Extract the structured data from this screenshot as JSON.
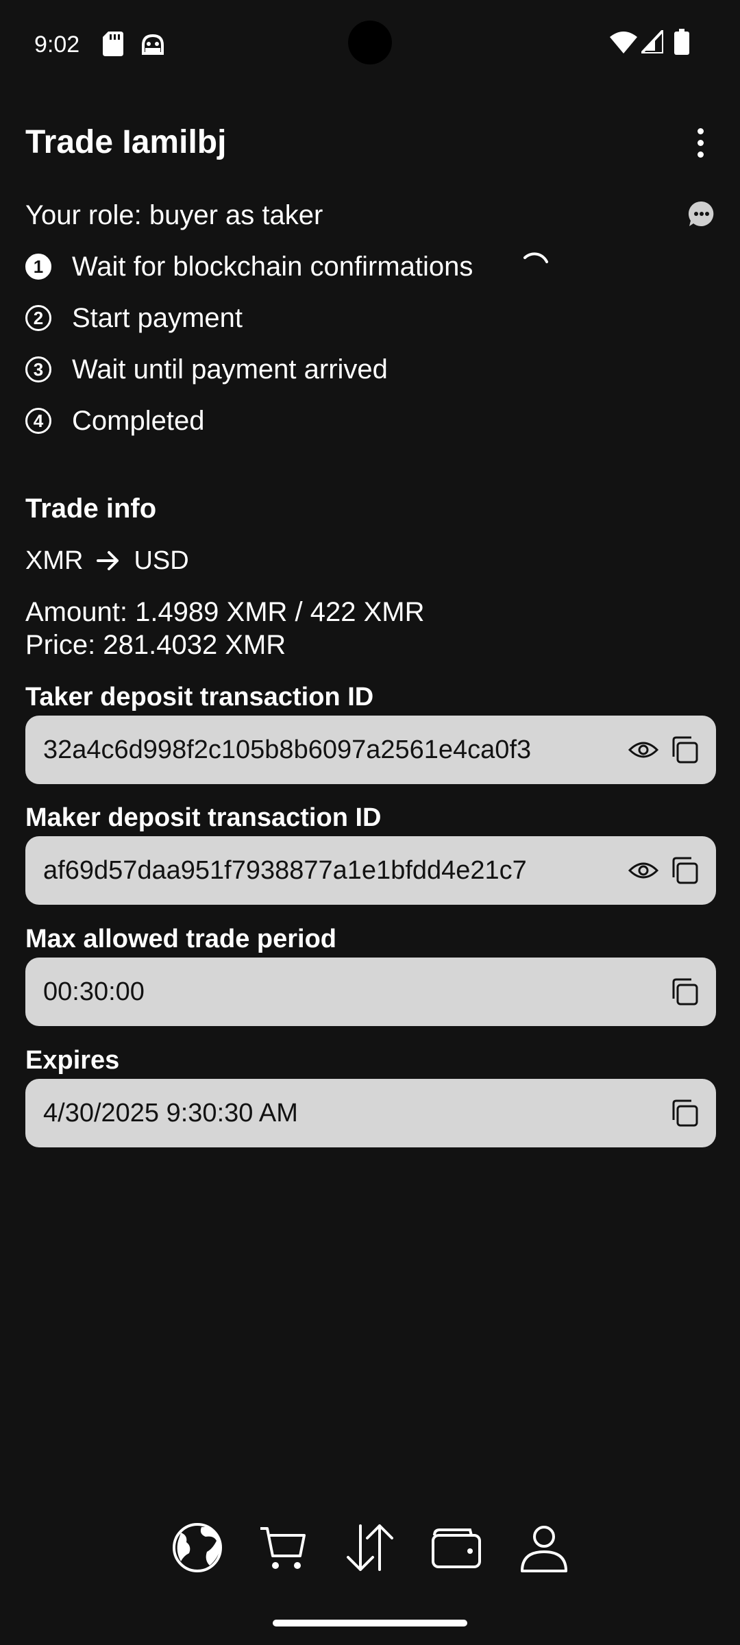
{
  "status_bar": {
    "time": "9:02",
    "icons": [
      "sd-card-icon",
      "android-debug-icon",
      "wifi-icon",
      "cell-signal-icon",
      "battery-icon"
    ]
  },
  "header": {
    "title": "Trade Iamilbj",
    "menu_icon": "more-vert-icon"
  },
  "role": {
    "text": "Your role: buyer as taker",
    "chat_icon": "chat-bubble-icon"
  },
  "steps": [
    {
      "number": "1",
      "label": "Wait for blockchain confirmations",
      "active": true
    },
    {
      "number": "2",
      "label": "Start payment",
      "active": false
    },
    {
      "number": "3",
      "label": "Wait until payment arrived",
      "active": false
    },
    {
      "number": "4",
      "label": "Completed",
      "active": false
    }
  ],
  "trade_info": {
    "title": "Trade info",
    "from_currency": "XMR",
    "to_currency": "USD",
    "amount": "Amount: 1.4989 XMR / 422 XMR",
    "price": "Price: 281.4032 XMR"
  },
  "fields": [
    {
      "label": "Taker deposit transaction ID",
      "value": "32a4c6d998f2c105b8b6097a2561e4ca0f3",
      "has_eye": true
    },
    {
      "label": "Maker deposit transaction ID",
      "value": "af69d57daa951f7938877a1e1bfdd4e21c7",
      "has_eye": true
    },
    {
      "label": "Max allowed trade period",
      "value": "00:30:00",
      "has_eye": false
    },
    {
      "label": "Expires",
      "value": "4/30/2025 9:30:30 AM",
      "has_eye": false
    }
  ],
  "bottom_nav": {
    "items": [
      "globe-icon",
      "cart-icon",
      "swap-icon",
      "wallet-icon",
      "profile-icon"
    ]
  },
  "colors": {
    "background": "#121212",
    "field_bg": "#d6d6d6",
    "text": "#ffffff"
  }
}
